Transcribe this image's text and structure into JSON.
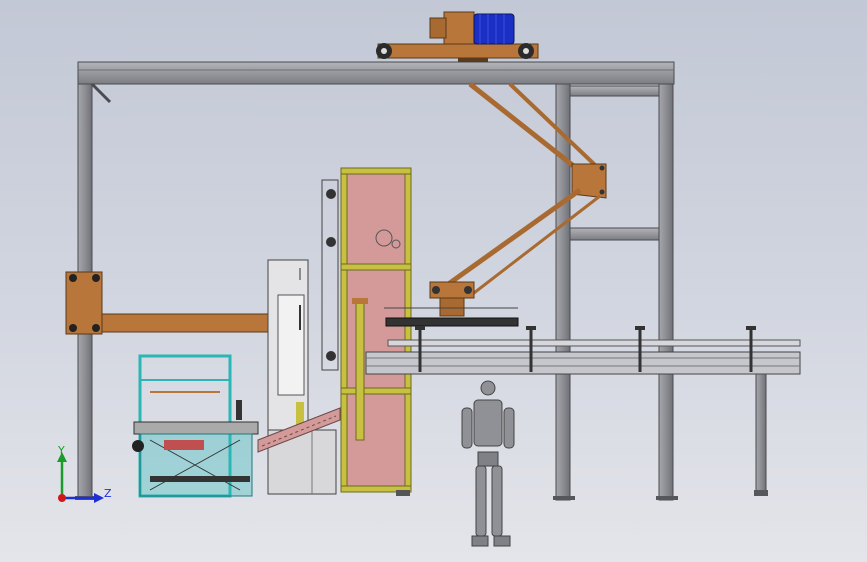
{
  "triad": {
    "y_label": "Y",
    "z_label": "Z",
    "y_color": "#1a9c2a",
    "z_color": "#1e2fd6",
    "x_color": "#d01818"
  },
  "colors": {
    "frame": "#8b8d93",
    "orange": "#b8763a",
    "motor": "#1b2fc4",
    "pink": "#d49a9a",
    "olive": "#c8c040",
    "teal": "#2bb6b6",
    "conveyor": "#9ea1a8",
    "robot": "#8f9196"
  }
}
